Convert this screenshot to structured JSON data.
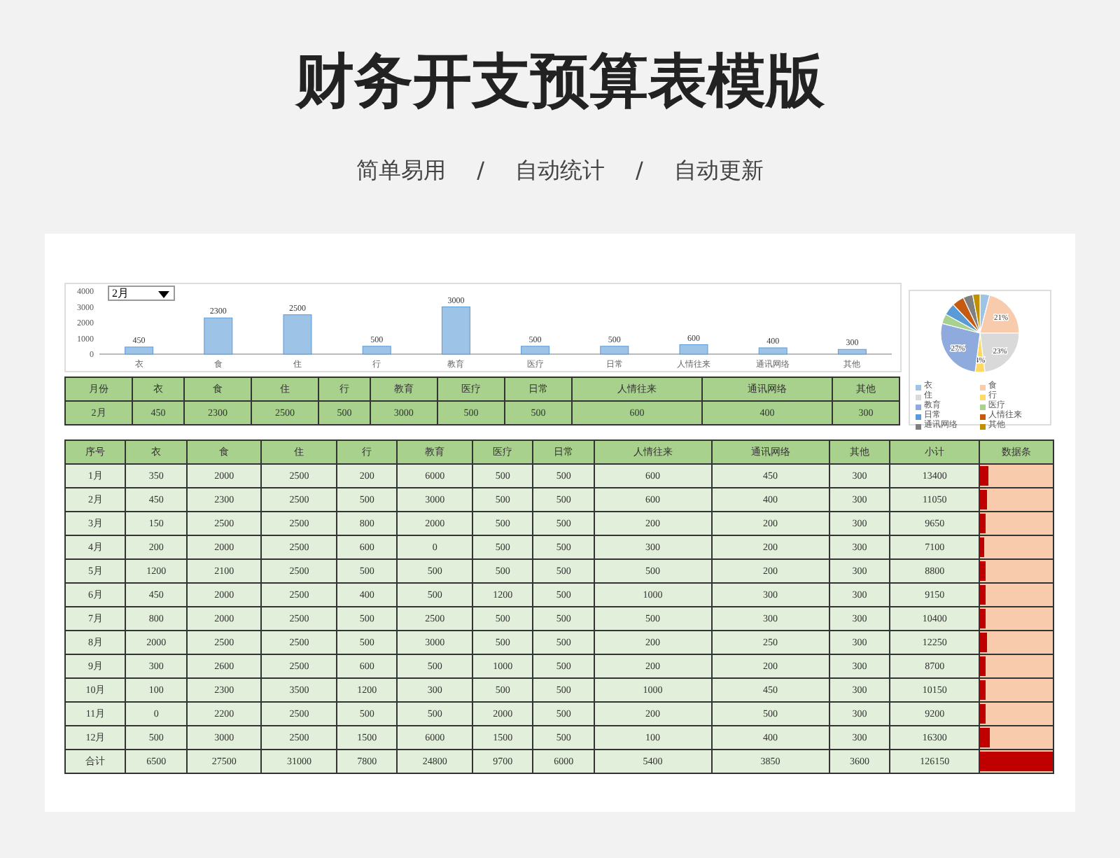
{
  "title": "财务开支预算表模版",
  "subtitle": [
    "简单易用",
    "/",
    "自动统计",
    "/",
    "自动更新"
  ],
  "month_select": {
    "value": "2月"
  },
  "bar_chart": {
    "chart_data": {
      "type": "bar",
      "categories": [
        "衣",
        "食",
        "住",
        "行",
        "教育",
        "医疗",
        "日常",
        "人情往来",
        "通讯网络",
        "其他"
      ],
      "values": [
        450,
        2300,
        2500,
        500,
        3000,
        500,
        500,
        600,
        400,
        300
      ],
      "ylim": [
        0,
        4000
      ],
      "yticks": [
        0,
        1000,
        2000,
        3000,
        4000
      ],
      "data_labels": true
    }
  },
  "pie_chart": {
    "chart_data": {
      "type": "pie",
      "categories": [
        "衣",
        "食",
        "住",
        "行",
        "教育",
        "医疗",
        "日常",
        "人情往来",
        "通讯网络",
        "其他"
      ],
      "values": [
        4,
        21,
        23,
        4,
        27,
        4,
        5,
        5,
        4,
        3
      ],
      "value_labels": [
        null,
        "21%",
        "23%",
        "4%",
        "27%",
        null,
        null,
        null,
        null,
        null
      ],
      "legend": true
    }
  },
  "summary_table": {
    "columns": [
      "月份",
      "衣",
      "食",
      "住",
      "行",
      "教育",
      "医疗",
      "日常",
      "人情往来",
      "通讯网络",
      "其他"
    ],
    "rows": [
      [
        "2月",
        "450",
        "2300",
        "2500",
        "500",
        "3000",
        "500",
        "500",
        "600",
        "400",
        "300"
      ]
    ]
  },
  "main_table": {
    "columns": [
      "序号",
      "衣",
      "食",
      "住",
      "行",
      "教育",
      "医疗",
      "日常",
      "人情往来",
      "通讯网络",
      "其他",
      "小计",
      "数据条"
    ],
    "rows": [
      {
        "cells": [
          "1月",
          "350",
          "2000",
          "2500",
          "200",
          "6000",
          "500",
          "500",
          "600",
          "450",
          "300",
          "13400"
        ],
        "level": 0.106
      },
      {
        "cells": [
          "2月",
          "450",
          "2300",
          "2500",
          "500",
          "3000",
          "500",
          "500",
          "600",
          "400",
          "300",
          "11050"
        ],
        "level": 0.088
      },
      {
        "cells": [
          "3月",
          "150",
          "2500",
          "2500",
          "800",
          "2000",
          "500",
          "500",
          "200",
          "200",
          "300",
          "9650"
        ],
        "level": 0.077
      },
      {
        "cells": [
          "4月",
          "200",
          "2000",
          "2500",
          "600",
          "0",
          "500",
          "500",
          "300",
          "200",
          "300",
          "7100"
        ],
        "level": 0.056
      },
      {
        "cells": [
          "5月",
          "1200",
          "2100",
          "2500",
          "500",
          "500",
          "500",
          "500",
          "500",
          "200",
          "300",
          "8800"
        ],
        "level": 0.07
      },
      {
        "cells": [
          "6月",
          "450",
          "2000",
          "2500",
          "400",
          "500",
          "1200",
          "500",
          "1000",
          "300",
          "300",
          "9150"
        ],
        "level": 0.073
      },
      {
        "cells": [
          "7月",
          "800",
          "2000",
          "2500",
          "500",
          "2500",
          "500",
          "500",
          "500",
          "300",
          "300",
          "10400"
        ],
        "level": 0.082
      },
      {
        "cells": [
          "8月",
          "2000",
          "2500",
          "2500",
          "500",
          "3000",
          "500",
          "500",
          "200",
          "250",
          "300",
          "12250"
        ],
        "level": 0.097
      },
      {
        "cells": [
          "9月",
          "300",
          "2600",
          "2500",
          "600",
          "500",
          "1000",
          "500",
          "200",
          "200",
          "300",
          "8700"
        ],
        "level": 0.069
      },
      {
        "cells": [
          "10月",
          "100",
          "2300",
          "3500",
          "1200",
          "300",
          "500",
          "500",
          "1000",
          "450",
          "300",
          "10150"
        ],
        "level": 0.08
      },
      {
        "cells": [
          "11月",
          "0",
          "2200",
          "2500",
          "500",
          "500",
          "2000",
          "500",
          "200",
          "500",
          "300",
          "9200"
        ],
        "level": 0.073
      },
      {
        "cells": [
          "12月",
          "500",
          "3000",
          "2500",
          "1500",
          "6000",
          "1500",
          "500",
          "100",
          "400",
          "300",
          "16300"
        ],
        "level": 0.129
      },
      {
        "cells": [
          "合计",
          "6500",
          "27500",
          "31000",
          "7800",
          "24800",
          "9700",
          "6000",
          "5400",
          "3850",
          "3600",
          "126150"
        ],
        "level": 1
      }
    ]
  }
}
